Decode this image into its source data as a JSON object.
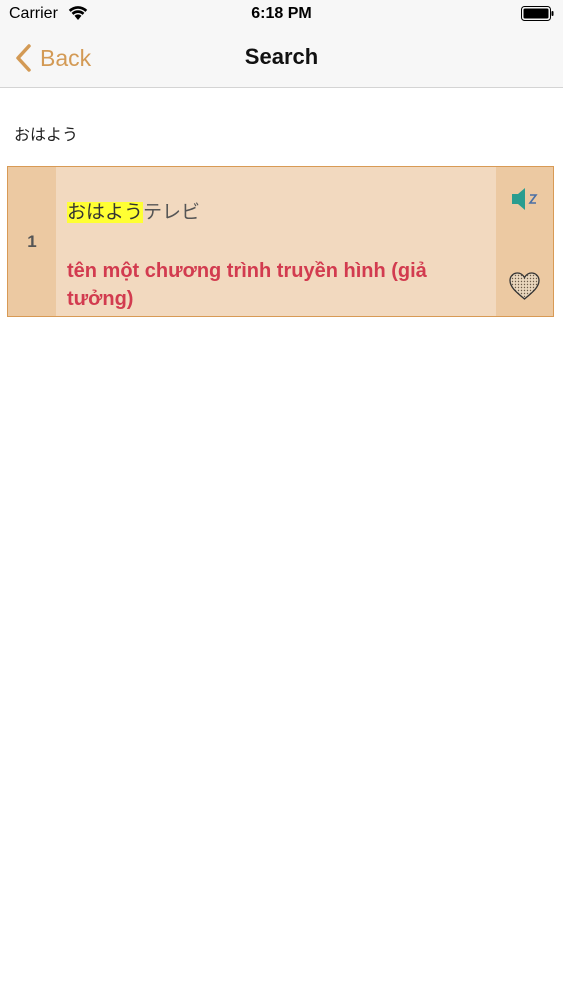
{
  "status_bar": {
    "carrier": "Carrier",
    "time": "6:18 PM",
    "icons": [
      "wifi-icon",
      "battery-icon"
    ]
  },
  "nav": {
    "back_label": "Back",
    "title": "Search",
    "accent_color": "#d39a55"
  },
  "search": {
    "query": "おはよう"
  },
  "results": [
    {
      "index": "1",
      "term_highlight": "おはよう",
      "term_rest": "テレビ",
      "meaning": "tên một chương trình truyền hình (giả tưởng)",
      "icons": [
        "speaker-icon",
        "heart-icon"
      ]
    }
  ],
  "colors": {
    "card_bg": "#f2d9bf",
    "card_side_bg": "#ecc9a2",
    "highlight": "#ffff33",
    "meaning_text": "#d23b4f"
  }
}
